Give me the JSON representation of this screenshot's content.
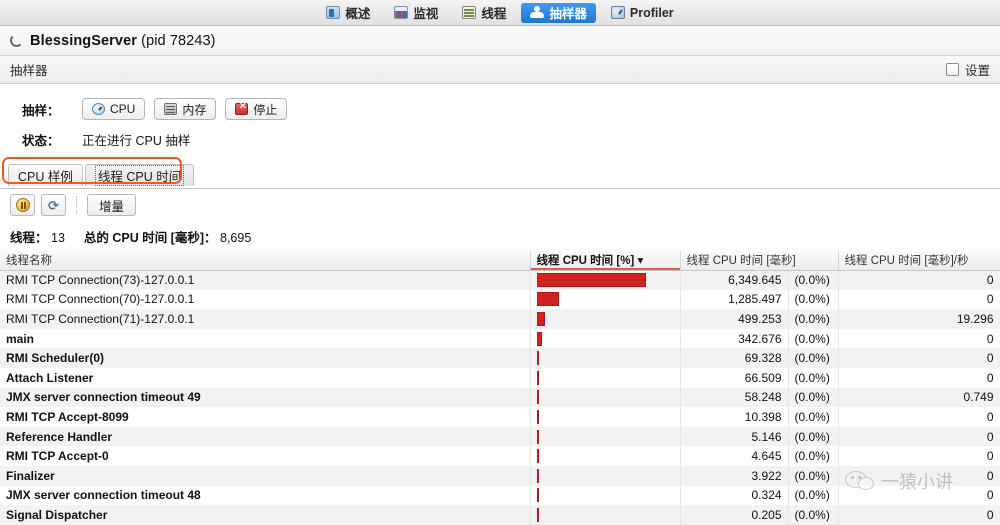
{
  "top_tabs": [
    {
      "label": "概述",
      "icon": "overview-icon",
      "selected": false
    },
    {
      "label": "监视",
      "icon": "monitor-icon",
      "selected": false
    },
    {
      "label": "线程",
      "icon": "threads-icon",
      "selected": false
    },
    {
      "label": "抽样器",
      "icon": "sampler-icon",
      "selected": true
    },
    {
      "label": "Profiler",
      "icon": "profiler-icon",
      "selected": false
    }
  ],
  "header": {
    "app_title": "BlessingServer",
    "pid_text": "(pid 78243)",
    "section_label": "抽样器",
    "settings_label": "设置"
  },
  "sampling": {
    "row_label": "抽样：",
    "cpu_button": "CPU",
    "memory_button": "内存",
    "stop_button": "停止",
    "status_label": "状态：",
    "status_value": "正在进行 CPU 抽样"
  },
  "subtabs": [
    {
      "label": "CPU 样例",
      "active": false
    },
    {
      "label": "线程 CPU 时间",
      "active": true
    }
  ],
  "toolbar": {
    "pause_icon": "pause-icon",
    "refresh_icon": "refresh-icon",
    "delta_button": "增量"
  },
  "summary": {
    "threads_label": "线程：",
    "threads_value": "13",
    "total_cpu_label": "总的 CPU 时间 [毫秒]：",
    "total_cpu_value": "8,695"
  },
  "table": {
    "columns": [
      {
        "key": "name",
        "label": "线程名称"
      },
      {
        "key": "bar",
        "label": "线程 CPU 时间 [%]",
        "sorted": true,
        "sort_dir": "desc"
      },
      {
        "key": "ms",
        "label": "线程 CPU 时间 [毫秒]"
      },
      {
        "key": "persec",
        "label": "线程 CPU 时间 [毫秒]/秒"
      }
    ],
    "rows": [
      {
        "name": "RMI TCP Connection(73)-127.0.0.1",
        "bold": false,
        "ms": "6,349.645",
        "pct": "(0.0%)",
        "persec": "0",
        "bar_pct": 100.0
      },
      {
        "name": "RMI TCP Connection(70)-127.0.0.1",
        "bold": false,
        "ms": "1,285.497",
        "pct": "(0.0%)",
        "persec": "0",
        "bar_pct": 20.2
      },
      {
        "name": "RMI TCP Connection(71)-127.0.0.1",
        "bold": false,
        "ms": "499.253",
        "pct": "(0.0%)",
        "persec": "19.296",
        "bar_pct": 7.9
      },
      {
        "name": "main",
        "bold": true,
        "ms": "342.676",
        "pct": "(0.0%)",
        "persec": "0",
        "bar_pct": 5.4
      },
      {
        "name": "RMI Scheduler(0)",
        "bold": true,
        "ms": "69.328",
        "pct": "(0.0%)",
        "persec": "0",
        "bar_pct": 1.1
      },
      {
        "name": "Attach Listener",
        "bold": true,
        "ms": "66.509",
        "pct": "(0.0%)",
        "persec": "0",
        "bar_pct": 1.0
      },
      {
        "name": "JMX server connection timeout 49",
        "bold": true,
        "ms": "58.248",
        "pct": "(0.0%)",
        "persec": "0.749",
        "bar_pct": 0.9
      },
      {
        "name": "RMI TCP Accept-8099",
        "bold": true,
        "ms": "10.398",
        "pct": "(0.0%)",
        "persec": "0",
        "bar_pct": 0.16
      },
      {
        "name": "Reference Handler",
        "bold": true,
        "ms": "5.146",
        "pct": "(0.0%)",
        "persec": "0",
        "bar_pct": 0.08
      },
      {
        "name": "RMI TCP Accept-0",
        "bold": true,
        "ms": "4.645",
        "pct": "(0.0%)",
        "persec": "0",
        "bar_pct": 0.07
      },
      {
        "name": "Finalizer",
        "bold": true,
        "ms": "3.922",
        "pct": "(0.0%)",
        "persec": "0",
        "bar_pct": 0.06
      },
      {
        "name": "JMX server connection timeout 48",
        "bold": true,
        "ms": "0.324",
        "pct": "(0.0%)",
        "persec": "0",
        "bar_pct": 0.01
      },
      {
        "name": "Signal Dispatcher",
        "bold": true,
        "ms": "0.205",
        "pct": "(0.0%)",
        "persec": "0",
        "bar_pct": 0.005
      }
    ]
  },
  "watermark": {
    "text": "一猿小讲",
    "icon": "wechat-icon"
  },
  "colors": {
    "bar": "#cf2222",
    "accent": "#2176cd",
    "annotation": "#ec5b25",
    "sort_underline": "#e05a4f"
  }
}
